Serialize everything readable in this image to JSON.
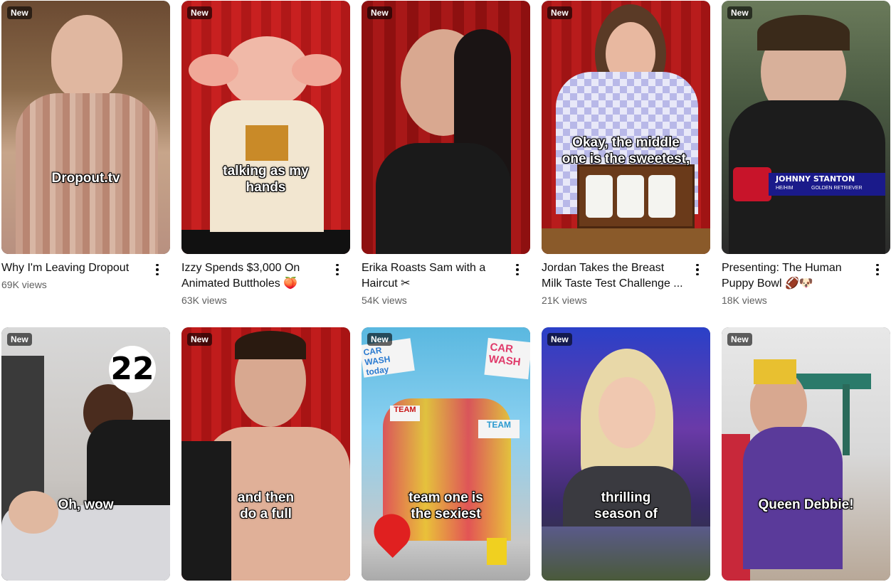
{
  "shorts": [
    {
      "badge": "New",
      "caption": "Dropout.tv",
      "title": "Why I'm Leaving Dropout",
      "views": "69K views"
    },
    {
      "badge": "New",
      "caption": "talking as my\nhands",
      "title": "Izzy Spends $3,000 On\nAnimated Buttholes 🍑",
      "views": "63K views"
    },
    {
      "badge": "New",
      "caption": "",
      "title": "Erika Roasts Sam with a\nHaircut ✂",
      "views": "54K views"
    },
    {
      "badge": "New",
      "caption": "Okay, the middle\none is the sweetest,",
      "title": "Jordan Takes the Breast\nMilk Taste Test Challenge ...",
      "views": "21K views"
    },
    {
      "badge": "New",
      "caption": "",
      "title": "Presenting: The Human\nPuppy Bowl 🏈🐶",
      "views": "18K views",
      "nameplate": {
        "name": "JOHNNY STANTON",
        "pronouns": "HE/HIM",
        "role": "GOLDEN RETRIEVER"
      }
    },
    {
      "badge": "New",
      "caption": "Oh, wow",
      "number": "22"
    },
    {
      "badge": "New",
      "caption": "and then\ndo a full"
    },
    {
      "badge": "New",
      "caption": "team one is\nthe sexiest",
      "signs": [
        "CAR WASH today",
        "CAR WASH",
        "TEAM",
        "TEAM"
      ]
    },
    {
      "badge": "New",
      "caption": "thrilling\nseason of"
    },
    {
      "badge": "New",
      "caption": "Queen Debbie!"
    }
  ],
  "colors": {
    "accent_red": "#c41414",
    "text": "#0f0f0f",
    "secondary": "#606060"
  }
}
